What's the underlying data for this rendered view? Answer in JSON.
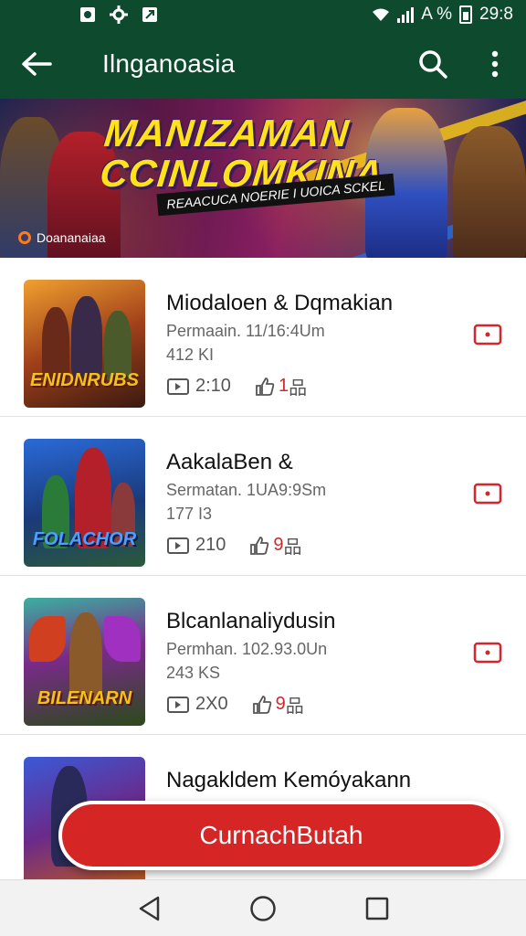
{
  "status_bar": {
    "indicator": "A %",
    "time": "29:8"
  },
  "app_bar": {
    "title": "Ilnganoasia"
  },
  "banner": {
    "title_line1": "MANIZAMAN",
    "title_line2": "CCINLOMKINA",
    "subtitle": "REAACUCA NOERIE I UOICA SCKEL",
    "brand": "Doananaiaa"
  },
  "items": [
    {
      "title": "Miodaloen & Dqmakian",
      "meta1": "Permaain. 11/16:4Um",
      "meta2": "412 KI",
      "views": "2:10",
      "likes": "1",
      "likes_suffix": "品",
      "thumb_text": "ENIDNRUBS"
    },
    {
      "title": "AakalaBen &",
      "meta1": "Sermatan. 1UA9:9Sm",
      "meta2": "177 I3",
      "views": "210",
      "likes": "9",
      "likes_suffix": "品",
      "thumb_text": "FOLACHOR"
    },
    {
      "title": "Blcanlanaliydusin",
      "meta1": "Permhan. 102.93.0Un",
      "meta2": "243 KS",
      "views": "2X0",
      "likes": "9",
      "likes_suffix": "品",
      "thumb_text": "BILENARN"
    },
    {
      "title": "Nagakldem Kemóyakann",
      "meta1": "",
      "meta2": "",
      "views": "",
      "likes": "",
      "likes_suffix": "",
      "thumb_text": ""
    }
  ],
  "cta": {
    "label": "CurnachButah"
  },
  "colors": {
    "primary": "#0d4a2e",
    "accent": "#d62525"
  }
}
